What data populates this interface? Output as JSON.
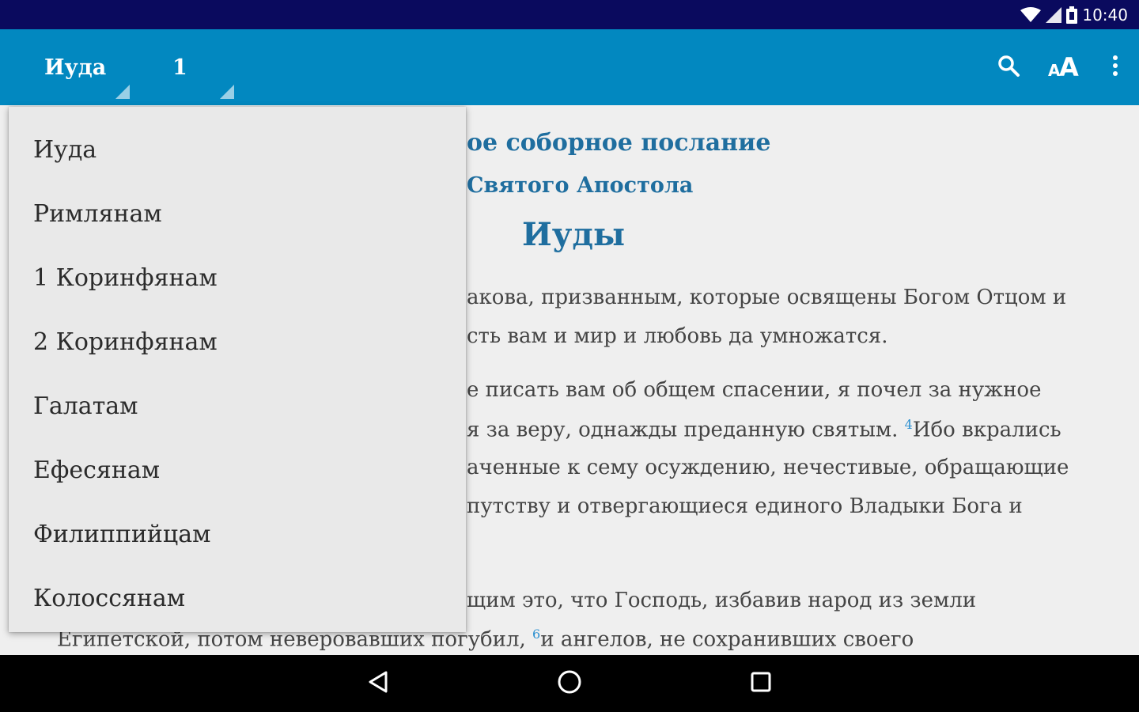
{
  "status": {
    "time": "10:40"
  },
  "toolbar": {
    "book": "Иуда",
    "chapter": "1",
    "actions": {
      "search_icon": "search-icon",
      "font_icon": "font-size-icon",
      "menu_icon": "more-vert-icon"
    }
  },
  "colors": {
    "statusbar": "#0a0a5e",
    "appbar": "#0288c0",
    "heading": "#1f6e9f",
    "verse_number": "#2a8fd0"
  },
  "dropdown": {
    "items": [
      "Иуда",
      "Римлянам",
      "1 Коринфянам",
      "2 Коринфянам",
      "Галатам",
      "Ефесянам",
      "Филиппийцам",
      "Колоссянам"
    ]
  },
  "content": {
    "heading1": "ое соборное послание",
    "heading2": "Святого Апостола",
    "heading3": "Иуды",
    "lines": [
      "акова, призванным, которые освящены Богом Отцом и",
      "сть вам и мир и любовь да умножатся.",
      "е писать вам об общем спасении, я почел за нужное",
      "я за веру, однажды преданную святым.",
      "аченные к сему осуждению, нечестивые, обращающие",
      "путству и отвергающиеся единого Владыки Бога и",
      "щим это, что Господь, избавив народ из земли",
      "Египетской, потом неверовавших погубил,"
    ],
    "line4_tail": "Ибо вкрались",
    "line8_tail": "и ангелов, не сохранивших своего",
    "verse4": "4",
    "verse6": "6"
  },
  "navbar": {
    "back_icon": "back-icon",
    "home_icon": "home-icon",
    "recents_icon": "recents-icon"
  }
}
